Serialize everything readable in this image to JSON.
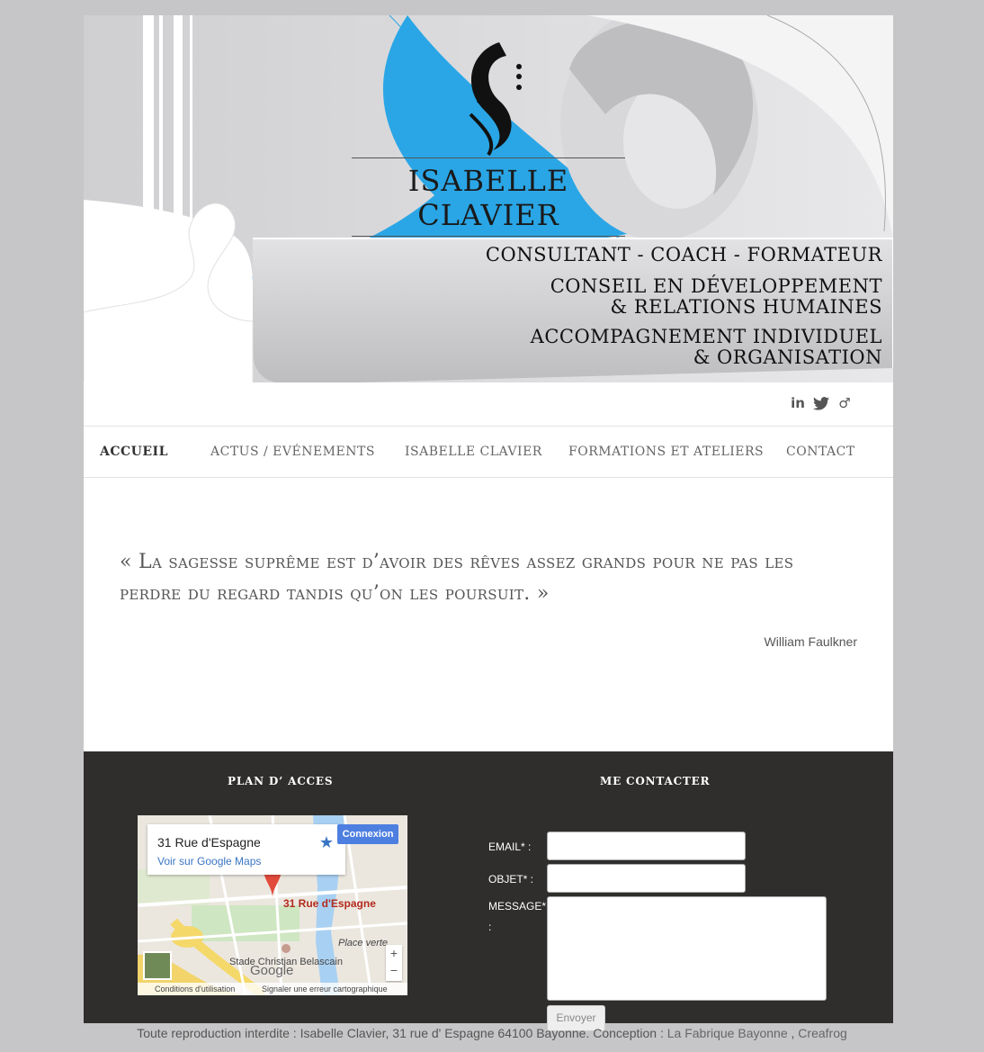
{
  "header": {
    "title": "ISABELLE CLAVIER",
    "tagline1": "CONSULTANT - COACH - FORMATEUR",
    "tagline2a": "CONSEIL EN DÉVELOPPEMENT",
    "tagline2b": "& RELATIONS HUMAINES",
    "tagline3a": "ACCOMPAGNEMENT INDIVIDUEL",
    "tagline3b": "& ORGANISATION",
    "brand_blue": "#2aa6e6"
  },
  "social": {
    "linkedin": "in",
    "twitter": "t",
    "other": "♂"
  },
  "nav": {
    "items": [
      {
        "label": "ACCUEIL"
      },
      {
        "label": "ACTUS / EVÉNEMENTS"
      },
      {
        "label": "ISABELLE CLAVIER"
      },
      {
        "label": "FORMATIONS ET ATELIERS"
      },
      {
        "label": "CONTACT"
      }
    ]
  },
  "quote": {
    "text": "« La sagesse suprême est d’avoir des rêves assez grands pour ne pas les perdre du regard tandis qu’on les poursuit.  »",
    "author": "William Faulkner"
  },
  "footer": {
    "map_heading": "PLAN D’ ACCES",
    "contact_heading": "ME CONTACTER",
    "map": {
      "address": "31 Rue d'Espagne",
      "link": "Voir sur Google Maps",
      "login": "Connexion",
      "pin_label": "31 Rue d'Espagne",
      "place1": "Place verte",
      "place2": "Stade Christian Belascain",
      "google": "Google",
      "terms": "Conditions d'utilisation",
      "report": "Signaler une erreur cartographique",
      "zoom_in": "+",
      "zoom_out": "−"
    },
    "form": {
      "email_label": "EMAIL* :",
      "subject_label": "OBJET* :",
      "message_label": "MESSAGE*",
      "message_colon": ":",
      "email_value": "",
      "subject_value": "",
      "message_value": "",
      "submit": "Envoyer"
    }
  },
  "copyright": {
    "text": "Toute reproduction interdite : Isabelle Clavier, 31 rue d' Espagne 64100 Bayonne. Conception : ",
    "link1": "La Fabrique Bayonne",
    "sep": " , ",
    "link2": "Creafrog"
  }
}
